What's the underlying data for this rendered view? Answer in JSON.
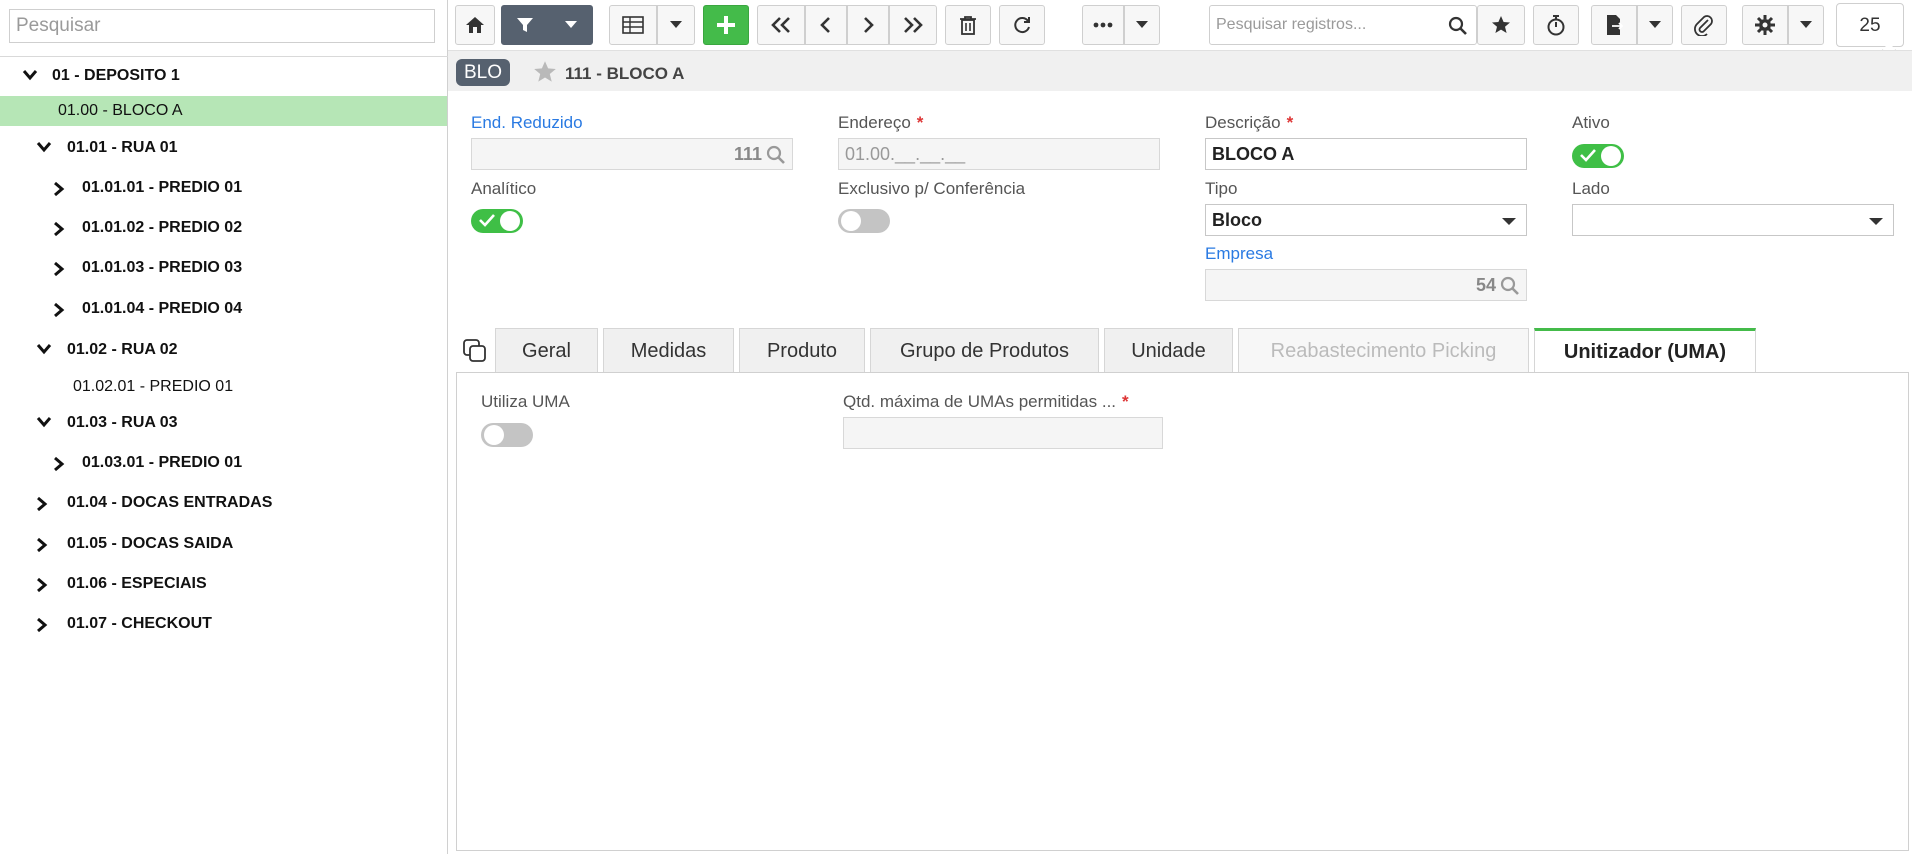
{
  "sidebar": {
    "search_placeholder": "Pesquisar",
    "tree": [
      {
        "label": "01 - DEPOSITO 1",
        "state": "expanded",
        "bold": true
      },
      {
        "label": "01.00 - BLOCO A",
        "state": "leaf",
        "bold": false,
        "selected": true
      },
      {
        "label": "01.01 - RUA 01",
        "state": "expanded",
        "bold": true
      },
      {
        "label": "01.01.01 - PREDIO 01",
        "state": "collapsed",
        "bold": true
      },
      {
        "label": "01.01.02 - PREDIO 02",
        "state": "collapsed",
        "bold": true
      },
      {
        "label": "01.01.03 - PREDIO 03",
        "state": "collapsed",
        "bold": true
      },
      {
        "label": "01.01.04 - PREDIO 04",
        "state": "collapsed",
        "bold": true
      },
      {
        "label": "01.02 - RUA 02",
        "state": "expanded",
        "bold": true
      },
      {
        "label": "01.02.01 - PREDIO 01",
        "state": "leaf",
        "bold": false
      },
      {
        "label": "01.03 - RUA 03",
        "state": "expanded",
        "bold": true
      },
      {
        "label": "01.03.01 - PREDIO 01",
        "state": "collapsed",
        "bold": true
      },
      {
        "label": "01.04 - DOCAS ENTRADAS",
        "state": "collapsed",
        "bold": true
      },
      {
        "label": "01.05 - DOCAS SAIDA",
        "state": "collapsed",
        "bold": true
      },
      {
        "label": "01.06 - ESPECIAIS",
        "state": "collapsed",
        "bold": true
      },
      {
        "label": "01.07 - CHECKOUT",
        "state": "collapsed",
        "bold": true
      }
    ]
  },
  "toolbar": {
    "search_placeholder": "Pesquisar registros...",
    "page_count": "25"
  },
  "header": {
    "badge": "BLO",
    "title": "111 - BLOCO A"
  },
  "form": {
    "end_reduzido": {
      "label": "End. Reduzido",
      "value": "111"
    },
    "endereco": {
      "label": "Endereço",
      "value": "01.00.__.__.__"
    },
    "descricao": {
      "label": "Descrição",
      "value": "BLOCO A"
    },
    "ativo": {
      "label": "Ativo",
      "on": true
    },
    "analitico": {
      "label": "Analítico",
      "on": true
    },
    "exclusivo": {
      "label": "Exclusivo p/ Conferência",
      "on": false
    },
    "tipo": {
      "label": "Tipo",
      "value": "Bloco"
    },
    "lado": {
      "label": "Lado",
      "value": ""
    },
    "empresa": {
      "label": "Empresa",
      "value": "54"
    }
  },
  "tabs": [
    {
      "label": "Geral",
      "state": "normal"
    },
    {
      "label": "Medidas",
      "state": "normal"
    },
    {
      "label": "Produto",
      "state": "normal"
    },
    {
      "label": "Grupo de Produtos",
      "state": "normal"
    },
    {
      "label": "Unidade",
      "state": "normal"
    },
    {
      "label": "Reabastecimento Picking",
      "state": "disabled"
    },
    {
      "label": "Unitizador (UMA)",
      "state": "active"
    }
  ],
  "tab_content": {
    "utiliza_uma": {
      "label": "Utiliza UMA",
      "on": false
    },
    "qtd_max": {
      "label": "Qtd. máxima de UMAs permitidas ...",
      "value": ""
    }
  },
  "colors": {
    "accent_green": "#44bb4a",
    "dark": "#56616f",
    "link_blue": "#2a7ae2",
    "selected_row": "#b6e6b6"
  }
}
